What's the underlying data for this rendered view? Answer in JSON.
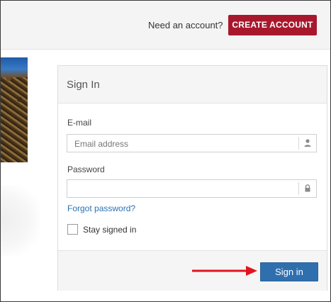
{
  "header": {
    "need_account_text": "Need an account?",
    "create_account_label": "CREATE ACCOUNT"
  },
  "signin": {
    "title": "Sign In",
    "email_label": "E-mail",
    "email_placeholder": "Email address",
    "email_value": "",
    "password_label": "Password",
    "password_value": "",
    "forgot_link": "Forgot password?",
    "stay_signed_in_label": "Stay signed in",
    "stay_signed_in_checked": false,
    "submit_label": "Sign in"
  },
  "icons": {
    "email_field_icon": "user-icon",
    "password_field_icon": "lock-icon",
    "annotation": "red-arrow-icon"
  },
  "colors": {
    "create_account_bg": "#a8182d",
    "signin_button_bg": "#2f6fae",
    "link": "#2a72b5",
    "arrow": "#e0141e"
  }
}
